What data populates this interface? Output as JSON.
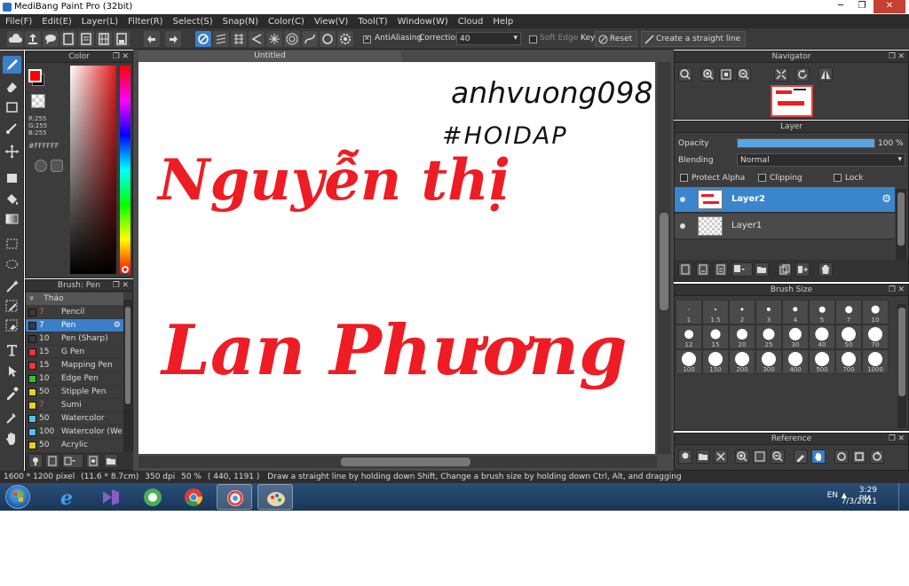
{
  "window": {
    "title": "MediBang Paint Pro (32bit)"
  },
  "menu": [
    "File(F)",
    "Edit(E)",
    "Layer(L)",
    "Filter(R)",
    "Select(S)",
    "Snap(N)",
    "Color(C)",
    "View(V)",
    "Tool(T)",
    "Window(W)",
    "Cloud",
    "Help"
  ],
  "toolbar": {
    "antialiasing_label": "AntiAliasing",
    "correction_label": "Correction",
    "correction_value": "40",
    "soft_edge_label": "Soft Edge",
    "key_label": "Key",
    "reset_label": "Reset",
    "straight_line_label": "Create a straight line"
  },
  "color_panel": {
    "title": "Color",
    "r": "R:255",
    "g": "G:255",
    "b": "B:255",
    "hex": "#FFFFFF",
    "primary_color": "#ff0000",
    "secondary_color": "#000000"
  },
  "brush_panel": {
    "title": "Brush: Pen",
    "group": "Thảo",
    "brushes": [
      {
        "size": "7",
        "name": "Pencil",
        "color": "#3a3a3a",
        "size_color": "#ff4a4a"
      },
      {
        "size": "7",
        "name": "Pen",
        "color": "#3a3a3a",
        "size_color": "#ff4a4a",
        "selected": true
      },
      {
        "size": "10",
        "name": "Pen (Sharp)",
        "color": "#3a3a3a",
        "size_color": "#dddddd"
      },
      {
        "size": "15",
        "name": "G Pen",
        "color": "#ff3030",
        "size_color": "#dddddd"
      },
      {
        "size": "15",
        "name": "Mapping Pen",
        "color": "#ff3030",
        "size_color": "#dddddd"
      },
      {
        "size": "10",
        "name": "Edge Pen",
        "color": "#30c030",
        "size_color": "#dddddd"
      },
      {
        "size": "50",
        "name": "Stipple Pen",
        "color": "#e8d020",
        "size_color": "#dddddd"
      },
      {
        "size": "7",
        "name": "Sumi",
        "color": "#e8d020",
        "size_color": "#ff4a4a"
      },
      {
        "size": "50",
        "name": "Watercolor",
        "color": "#50c0f0",
        "size_color": "#dddddd"
      },
      {
        "size": "100",
        "name": "Watercolor (We",
        "color": "#50c0f0",
        "size_color": "#dddddd"
      },
      {
        "size": "50",
        "name": "Acrylic",
        "color": "#e8d020",
        "size_color": "#dddddd"
      }
    ]
  },
  "document": {
    "tab": "Untitled",
    "artwork_lines": {
      "line1": "anhvuong098",
      "line2": "#HOIDAP",
      "line3": "Nguyễn thị",
      "line4": "Lan Phương"
    }
  },
  "navigator": {
    "title": "Navigator"
  },
  "layer_panel": {
    "title": "Layer",
    "opacity_label": "Opacity",
    "opacity_value": "100 %",
    "opacity_fraction": 1.0,
    "blending_label": "Blending",
    "blending_value": "Normal",
    "protect_alpha_label": "Protect Alpha",
    "clipping_label": "Clipping",
    "lock_label": "Lock",
    "layers": [
      {
        "name": "Layer2",
        "selected": true
      },
      {
        "name": "Layer1",
        "selected": false
      }
    ]
  },
  "brush_size_panel": {
    "title": "Brush Size",
    "sizes": [
      "1",
      "1.5",
      "2",
      "3",
      "4",
      "5",
      "7",
      "10",
      "12",
      "15",
      "20",
      "25",
      "30",
      "40",
      "50",
      "70",
      "100",
      "150",
      "200",
      "300",
      "400",
      "500",
      "700",
      "1000"
    ]
  },
  "reference_panel": {
    "title": "Reference"
  },
  "status": {
    "dimensions": "1600 * 1200 pixel",
    "physical": "(11.6 * 8.7cm)",
    "dpi": "350 dpi",
    "zoom": "50 %",
    "coords": "( 440, 1191 )",
    "hint": "Draw a straight line by holding down Shift, Change a brush size by holding down Ctrl, Alt, and dragging"
  },
  "taskbar": {
    "language": "EN",
    "time": "3:29 PM",
    "date": "7/3/2021"
  }
}
